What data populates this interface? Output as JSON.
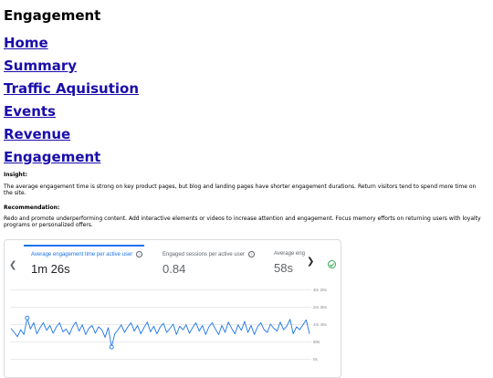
{
  "page": {
    "title": "Engagement",
    "nav": [
      "Home",
      "Summary",
      "Traffic Aquisution",
      "Events",
      "Revenue",
      "Engagement"
    ],
    "insight_heading": "Insight:",
    "insight_text": "The average engagement time is strong on key product pages, but blog and landing pages have shorter engagement durations. Return visitors tend to spend more time on the site.",
    "recommendation_heading": "Recommendation:",
    "recommendation_text": "Redo and promote underperforming content. Add interactive elements or videos to increase attention and engagement. Focus memory efforts on returning users with loyalty programs or personalized offers."
  },
  "card": {
    "metrics": [
      {
        "label": "Average engagement time per active user",
        "value": "1m 26s",
        "color": "#1a73e8"
      },
      {
        "label": "Engaged sessions per active user",
        "value": "0.84",
        "color": "#5f6368"
      },
      {
        "label": "Average eng",
        "value": "58s",
        "color": "#5f6368"
      }
    ],
    "y_ticks": [
      "3m 20s",
      "2m 30s",
      "1m 40s",
      "50s",
      "0s"
    ],
    "icons": {
      "left": "chevron-left-icon",
      "right": "chevron-right-icon",
      "status": "check-circle-icon"
    }
  },
  "chart_data": {
    "type": "line",
    "ylim": [
      0,
      200
    ],
    "ylabel": "",
    "xlabel": "",
    "color": "#1a73e8",
    "values": [
      88,
      76,
      64,
      84,
      70,
      118,
      86,
      104,
      72,
      90,
      104,
      82,
      96,
      74,
      92,
      104,
      78,
      86,
      70,
      92,
      106,
      80,
      98,
      70,
      88,
      96,
      74,
      92,
      84,
      62,
      90,
      34,
      72,
      84,
      98,
      76,
      92,
      104,
      80,
      96,
      72,
      90,
      106,
      78,
      94,
      72,
      92,
      102,
      76,
      88,
      100,
      70,
      94,
      84,
      98,
      74,
      90,
      104,
      80,
      96,
      70,
      92,
      104,
      86,
      70,
      96,
      76,
      106,
      88,
      72,
      98,
      82,
      108,
      76,
      96,
      70,
      92,
      104,
      84,
      76,
      100,
      88,
      80,
      106,
      84,
      94,
      114,
      72,
      92,
      84,
      98,
      112,
      72
    ],
    "markers": [
      5,
      31
    ]
  }
}
